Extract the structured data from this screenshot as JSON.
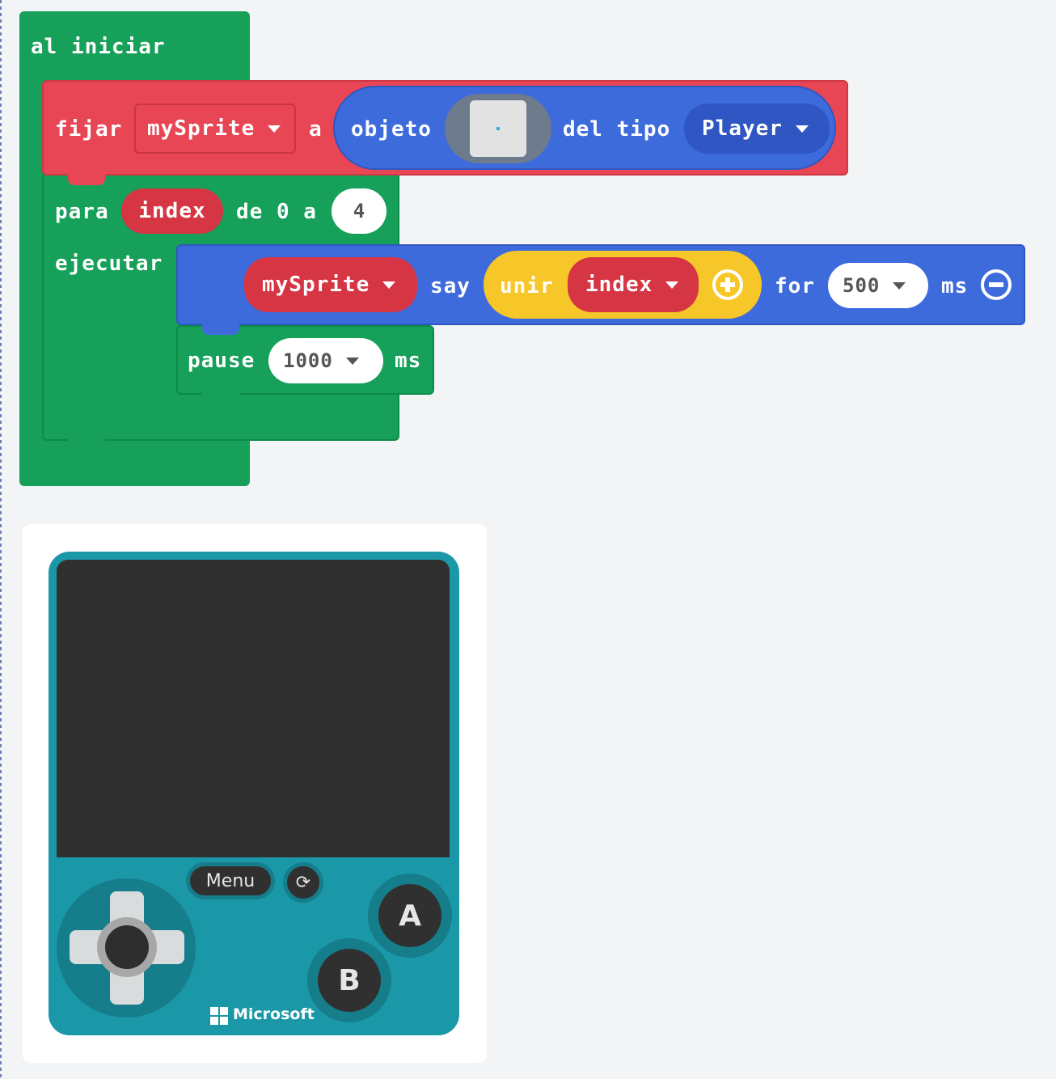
{
  "colors": {
    "loops_green": "#16a05a",
    "sprites_red": "#e84654",
    "variable_red": "#d63543",
    "sprite_blue": "#3e6bdc",
    "text_yellow": "#f7c628",
    "console_teal": "#1b98a8"
  },
  "blocks": {
    "on_start": {
      "label": "al iniciar"
    },
    "set_sprite": {
      "label_set": "fijar",
      "variable": "mySprite",
      "label_to": "a",
      "label_sprite": "objeto",
      "label_kind": "del tipo",
      "kind": "Player"
    },
    "for_loop": {
      "label_for": "para",
      "variable": "index",
      "label_range": "de 0 a",
      "upper": "4",
      "label_do": "ejecutar"
    },
    "say": {
      "sprite": "mySprite",
      "label_say": "say",
      "label_join": "unir",
      "join_item": "index",
      "label_for": "for",
      "duration": "500",
      "unit": "ms"
    },
    "pause": {
      "label": "pause",
      "value": "1000",
      "unit": "ms"
    }
  },
  "simulator": {
    "menu_label": "Menu",
    "a_label": "A",
    "b_label": "B",
    "brand": "Microsoft"
  },
  "icons": {
    "add": "plus-circle-icon",
    "remove": "minus-circle-icon",
    "dropdown": "caret-down-icon",
    "reset": "refresh-icon",
    "dpad": "dpad-icon",
    "brand_logo": "microsoft-logo-icon"
  }
}
